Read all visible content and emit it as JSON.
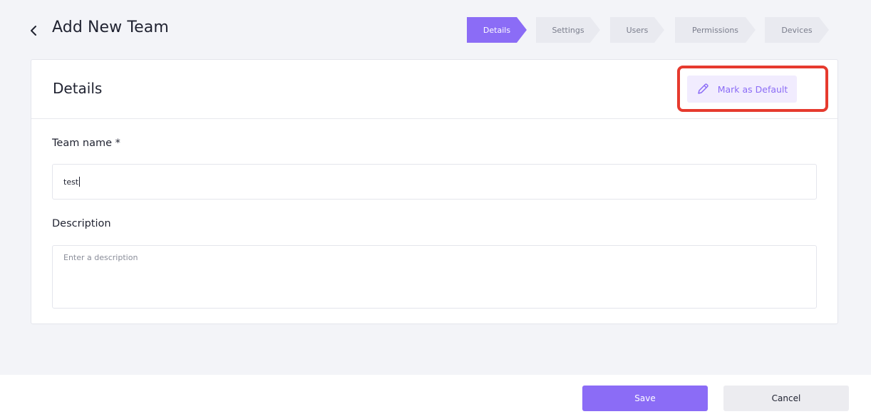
{
  "header": {
    "title": "Add New Team",
    "back_icon": "chevron-left-icon"
  },
  "stepper": {
    "steps": [
      "Details",
      "Settings",
      "Users",
      "Permissions",
      "Devices"
    ],
    "active": "Details"
  },
  "card": {
    "title": "Details",
    "default_button_label": "Mark as Default",
    "default_button_icon": "pencil-icon"
  },
  "form": {
    "team_name_label": "Team name *",
    "team_name_value": "test",
    "description_label": "Description",
    "description_placeholder": "Enter a description"
  },
  "footer": {
    "save_label": "Save",
    "cancel_label": "Cancel"
  },
  "colors": {
    "accent": "#8b6cf6",
    "highlight": "#e63a2e"
  }
}
